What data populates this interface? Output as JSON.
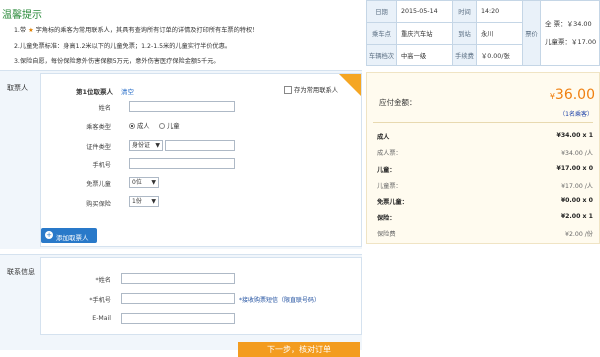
{
  "tips": {
    "title": "温馨提示",
    "line1_a": "1.带",
    "line1_b": "字角标的乘客为常用联系人，其具有查询所有订单的详情及打印所有车票的特权！",
    "line2": "2.儿童免票标准：身高1.2米以下的儿童免票；1.2-1.5米的儿童实行半价优惠。",
    "line3": "3.保险自愿，每份保险意外伤害保额5万元，意外伤害医疗保险金额5千元。"
  },
  "passenger": {
    "section_label": "取票人",
    "header": "第1位取票人",
    "clear": "清空",
    "save_label": "存为常用联系人",
    "name_label": "姓名",
    "name_value": "",
    "type_label": "乘客类型",
    "type_adult": "成人",
    "type_child": "儿童",
    "id_label": "证件类型",
    "id_type": "身份证",
    "id_value": "",
    "phone_label": "手机号",
    "phone_value": "",
    "free_child_label": "免票儿童",
    "free_child_value": "0位",
    "insurance_label": "购买保险",
    "insurance_value": "1份",
    "add_button": "添加取票人"
  },
  "contact": {
    "section_label": "联系信息",
    "name_label": "*姓名",
    "phone_label": "*手机号",
    "phone_note": "*接收购票短信（限直联号码）",
    "email_label": "E-Mail",
    "next_button": "下一步，核对订单"
  },
  "trip": {
    "date_label": "日期",
    "date_value": "2015-05-14",
    "time_label": "时间",
    "time_value": "14:20",
    "from_label": "乘车点",
    "from_value": "重庆汽车站",
    "to_label": "到站",
    "to_value": "永川",
    "bus_label": "车辆档次",
    "bus_value": "中高一级",
    "fee_label": "手续费",
    "fee_value": "￥0.00/张",
    "price_label": "票价",
    "full_label": "全  票：",
    "full_value": "￥34.00",
    "child_label": "儿童票：",
    "child_value": "￥17.00"
  },
  "fees": {
    "total_label": "应付金额：",
    "total_currency": "¥",
    "total_value": "36.00",
    "count": "（1名乘客）",
    "rows": [
      {
        "label": "成人",
        "value": "¥34.00 x 1"
      },
      {
        "label": "成人票：",
        "value": "¥34.00 /人"
      },
      {
        "label": "儿童：",
        "value": "¥17.00 x 0"
      },
      {
        "label": "儿童票：",
        "value": "¥17.00 /人"
      },
      {
        "label": "免票儿童：",
        "value": "¥0.00 x 0"
      },
      {
        "label": "保险：",
        "value": "¥2.00 x 1"
      },
      {
        "label": "保险费",
        "value": "¥2.00 /份"
      }
    ]
  }
}
